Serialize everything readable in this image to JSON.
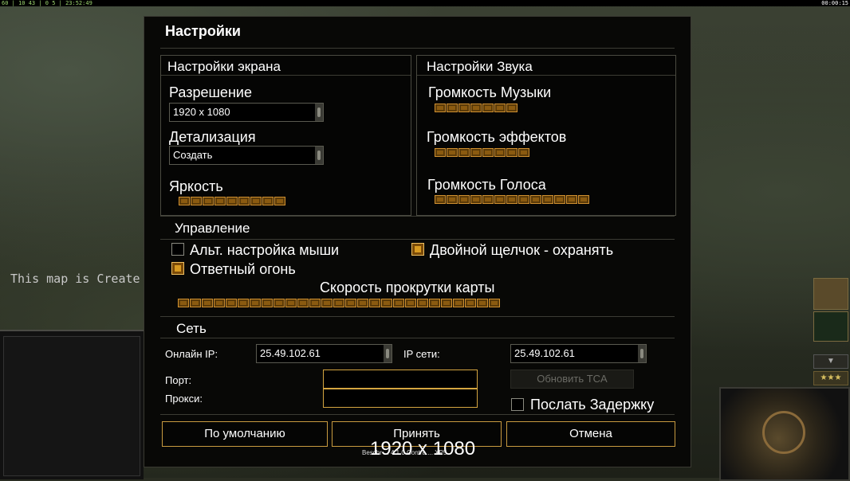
{
  "topbar": {
    "stats": "60 | 10 43 | 0 5 | 23:52:49",
    "time": "00:00:15"
  },
  "map_message": "This map is Create",
  "bottom_text": "Beschr ... 4.1.0 Contra ... XP5",
  "dialog": {
    "title": "Настройки",
    "display": {
      "section_title": "Настройки экрана",
      "resolution_label": "Разрешение",
      "resolution_value": "1920 x 1080",
      "detail_label": "Детализация",
      "detail_value": "Создать",
      "brightness_label": "Яркость",
      "brightness_level": 9
    },
    "sound": {
      "section_title": "Настройки Звука",
      "music_label": "Громкость Музыки",
      "music_level": 7,
      "effects_label": "Громкость эффектов",
      "effects_level": 8,
      "voice_label": "Громкость Голоса",
      "voice_level": 13
    },
    "controls": {
      "section_title": "Управление",
      "alt_mouse_label": "Альт. настройка мыши",
      "alt_mouse_checked": false,
      "double_click_label": "Двойной щелчок - охранять",
      "double_click_checked": true,
      "return_fire_label": "Ответный огонь",
      "return_fire_checked": true,
      "scroll_speed_label": "Скорость прокрутки карты",
      "scroll_speed_level": 27
    },
    "network": {
      "section_title": "Сеть",
      "online_ip_label": "Онлайн IP:",
      "online_ip_value": "25.49.102.61",
      "lan_ip_label": "IP сети:",
      "lan_ip_value": "25.49.102.61",
      "port_label": "Порт:",
      "port_value": "",
      "proxy_label": "Прокси:",
      "proxy_value": "",
      "update_tca_label": "Обновить TCA",
      "send_delay_label": "Послать Задержку",
      "send_delay_checked": false
    },
    "buttons": {
      "default_label": "По умолчанию",
      "accept_label": "Принять",
      "cancel_label": "Отмена"
    }
  },
  "overlay_resolution": "1920 x 1080",
  "colors": {
    "accent": "#d4a540",
    "slider": "#8a5a10",
    "background": "#080806"
  }
}
